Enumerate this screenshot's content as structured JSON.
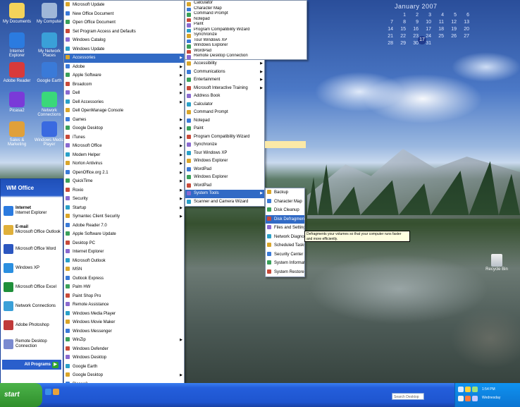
{
  "calendar": {
    "title": "January 2007",
    "rows": [
      [
        "",
        "1",
        "2",
        "3",
        "4",
        "5",
        "6"
      ],
      [
        "7",
        "8",
        "9",
        "10",
        "11",
        "12",
        "13"
      ],
      [
        "14",
        "15",
        "16",
        "17",
        "18",
        "19",
        "20"
      ],
      [
        "21",
        "22",
        "23",
        "24",
        "25",
        "26",
        "27"
      ],
      [
        "28",
        "29",
        "30",
        "31",
        "",
        "",
        ""
      ]
    ],
    "today": "17"
  },
  "desktop_icons": [
    {
      "label": "My Documents"
    },
    {
      "label": "My Computer"
    },
    {
      "label": "Internet Explorer"
    },
    {
      "label": "My Network Places"
    },
    {
      "label": "Adobe Reader"
    },
    {
      "label": "Google Earth"
    },
    {
      "label": "Picasa2"
    },
    {
      "label": "Network Connections"
    },
    {
      "label": "Sales & Marketing"
    },
    {
      "label": "Windows Media Player"
    }
  ],
  "start_menu": {
    "user": "WM Office",
    "pinned": [
      {
        "title": "Internet",
        "sub": "Internet Explorer"
      },
      {
        "title": "E-mail",
        "sub": "Microsoft Office Outlook"
      },
      {
        "title": "Microsoft Office Word",
        "sub": ""
      },
      {
        "title": "Windows XP",
        "sub": ""
      },
      {
        "title": "Microsoft Office Excel",
        "sub": ""
      },
      {
        "title": "Network Connections",
        "sub": ""
      },
      {
        "title": "Adobe Photoshop",
        "sub": ""
      },
      {
        "title": "Remote Desktop Connection",
        "sub": ""
      }
    ],
    "all_programs": "All Programs"
  },
  "menu1": [
    "Microsoft Update",
    "New Office Document",
    "Open Office Document",
    "Set Program Access and Defaults",
    "Windows Catalog",
    "Windows Update",
    "Accessories",
    "Adobe",
    "Apple Software",
    "Broadcom",
    "Dell",
    "Dell Accessories",
    "Dell OpenManage Console",
    "Games",
    "Google Desktop",
    "iTunes",
    "Microsoft Office",
    "Modem Helper",
    "Norton Antivirus",
    "OpenOffice.org 2.1",
    "QuickTime",
    "Roxio",
    "Security",
    "Startup",
    "Symantec Client Security",
    "Adobe Reader 7.0",
    "Apple Software Update",
    "Desktop PC",
    "Internet Explorer",
    "Microsoft Outlook",
    "MSN",
    "Outlook Express",
    "Palm HW",
    "Paint Shop Pro",
    "Remote Assistance",
    "Windows Media Player",
    "Windows Movie Maker",
    "Windows Messenger",
    "WinZip",
    "Windows Defender",
    "Windows Desktop",
    "Google Earth",
    "Google Desktop",
    "Picasa2"
  ],
  "menu1_selected": "Accessories",
  "menu2": [
    "Calculator",
    "Character Map",
    "Command Prompt",
    "Notepad",
    "Paint",
    "Program Compatibility Wizard",
    "Synchronize",
    "Tour Windows XP",
    "Windows Explorer",
    "WordPad",
    "Remote Desktop Connection"
  ],
  "menu3": [
    "Accessibility",
    "Communications",
    "Entertainment",
    "Microsoft Interactive Training",
    "Address Book",
    "Calculator",
    "Command Prompt",
    "Notepad",
    "Paint",
    "Program Compatibility Wizard",
    "Synchronize",
    "Tour Windows XP",
    "Windows Explorer",
    "WordPad",
    "Windows Explorer",
    "WordPad",
    "System Tools",
    "Scanner and Camera Wizard"
  ],
  "menu3_selected": "System Tools",
  "menu4": [
    "Backup",
    "Character Map",
    "Disk Cleanup",
    "Disk Defragmenter",
    "Files and Settings Transfer Wizard",
    "Network Diagnosis",
    "Scheduled Tasks",
    "Security Center",
    "System Information",
    "System Restore"
  ],
  "menu4_selected": "Disk Defragmenter",
  "tooltip": "Defragments your volumes so that your computer runs faster and more efficiently.",
  "taskbar": {
    "start": "start",
    "search_placeholder": "Search Desktop",
    "time": "1:54 PM",
    "day": "Wednesday"
  },
  "recycle_bin": "Recycle Bin",
  "colors": {
    "menu_highlight": "#316ac5",
    "taskbar": "#245edb",
    "start_green": "#3ca23a"
  }
}
